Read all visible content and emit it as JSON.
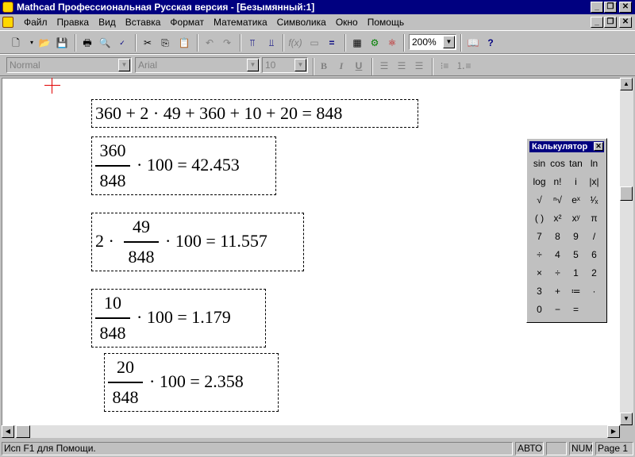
{
  "window": {
    "title": "Mathcad Профессиональная Русская версия - [Безымянный:1]"
  },
  "menu": [
    {
      "label": "Файл"
    },
    {
      "label": "Правка"
    },
    {
      "label": "Вид"
    },
    {
      "label": "Вставка"
    },
    {
      "label": "Формат"
    },
    {
      "label": "Математика"
    },
    {
      "label": "Символика"
    },
    {
      "label": "Окно"
    },
    {
      "label": "Помощь"
    }
  ],
  "toolbar": {
    "zoom": "200%"
  },
  "format_bar": {
    "style": "Normal",
    "font": "Arial",
    "size": "10",
    "bold": "B",
    "italic": "I",
    "underline": "U"
  },
  "regions": {
    "r1": {
      "text": "360 + 2 · 49 + 360 + 10 + 20 = 848"
    },
    "r2": {
      "num": "360",
      "den": "848",
      "rest": "· 100 = 42.453"
    },
    "r3": {
      "pre": "2 ·",
      "num": "49",
      "den": "848",
      "rest": "· 100 = 11.557"
    },
    "r4": {
      "num": "10",
      "den": "848",
      "rest": "· 100 = 1.179"
    },
    "r5": {
      "num": "20",
      "den": "848",
      "rest": "· 100 = 2.358"
    }
  },
  "calculator": {
    "title": "Калькулятор",
    "keys": [
      "sin",
      "cos",
      "tan",
      "ln",
      "log",
      "n!",
      "i",
      "|x|",
      "√",
      "ⁿ√",
      "eˣ",
      "¹⁄ₓ",
      "( )",
      "x²",
      "xʸ",
      "π",
      "7",
      "8",
      "9",
      "/",
      "÷",
      "4",
      "5",
      "6",
      "×",
      "÷",
      "1",
      "2",
      "3",
      "+",
      "≔",
      "·",
      "0",
      "−",
      "=",
      ""
    ]
  },
  "status": {
    "help": "Исп F1 для Помощи.",
    "mode": "АВТО",
    "num": "NUM",
    "page": "Page 1"
  }
}
